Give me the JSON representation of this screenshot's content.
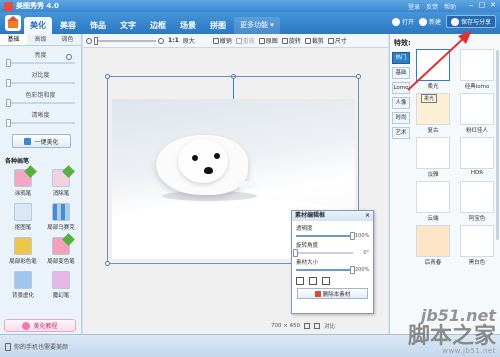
{
  "app": {
    "title": "美图秀秀 4.0"
  },
  "titlebar_links": [
    "登录",
    "反馈",
    "帮助"
  ],
  "tabs": [
    {
      "label": "美化",
      "active": true
    },
    {
      "label": "美容",
      "active": false
    },
    {
      "label": "饰品",
      "active": false
    },
    {
      "label": "文字",
      "active": false
    },
    {
      "label": "边框",
      "active": false
    },
    {
      "label": "场景",
      "active": false
    },
    {
      "label": "拼图",
      "active": false
    }
  ],
  "more_functions": "更多功能 ▾",
  "top_actions": {
    "open": "打开",
    "new": "新建",
    "save_share": "保存与分享"
  },
  "left": {
    "subtabs": [
      "基础",
      "高级",
      "调色"
    ],
    "sliders": [
      {
        "label": "亮度",
        "value": 0
      },
      {
        "label": "对比度",
        "value": 0
      },
      {
        "label": "色彩饱和度",
        "value": 0
      },
      {
        "label": "清晰度",
        "value": 0
      }
    ],
    "onekey": "一键美化",
    "brushes_title": "各种画笔",
    "tools": [
      {
        "label": "涂鸦笔",
        "new": true
      },
      {
        "label": "消除笔",
        "new": true
      },
      {
        "label": "抠图笔",
        "new": false
      },
      {
        "label": "局部马赛克",
        "new": false
      },
      {
        "label": "局部彩色笔",
        "new": false
      },
      {
        "label": "局部变色笔",
        "new": true
      },
      {
        "label": "背景虚化",
        "new": false
      },
      {
        "label": "魔幻笔",
        "new": false
      }
    ],
    "tutorial": "美化教程"
  },
  "toolbar": {
    "ratio": "1:1",
    "original": "原大",
    "undo": "撤销",
    "redo": "重做",
    "orig_image": "原图",
    "rotate": "旋转",
    "crop": "裁剪",
    "size": "尺寸"
  },
  "canvas": {
    "dimensions": "700 × 450",
    "compare": "对比"
  },
  "material_panel": {
    "title": "素材编辑框",
    "transparency_label": "透明度",
    "transparency_value": "100%",
    "transparency": 1.0,
    "rotation_label": "旋转角度",
    "rotation_value": "0°",
    "rotation": 0.0,
    "size_label": "素材大小",
    "size_value": "200%",
    "size": 1.0,
    "delete": "删除本素材"
  },
  "right": {
    "title": "特效:",
    "categories": [
      {
        "label": "热门",
        "active": true
      },
      {
        "label": "基础",
        "active": false
      },
      {
        "label": "Lomo",
        "active": false
      },
      {
        "label": "人像",
        "active": false
      },
      {
        "label": "时尚",
        "active": false
      },
      {
        "label": "艺术",
        "active": false
      }
    ],
    "effects": [
      {
        "label": "柔光",
        "selected": true
      },
      {
        "label": "经典lomo",
        "selected": false
      },
      {
        "label": "复古",
        "selected": false
      },
      {
        "label": "粉红佳人",
        "selected": false
      },
      {
        "label": "淡雅",
        "selected": false
      },
      {
        "label": "HDR",
        "selected": false
      },
      {
        "label": "云端",
        "selected": false
      },
      {
        "label": "阿宝色",
        "selected": false
      },
      {
        "label": "后青春",
        "selected": false
      },
      {
        "label": "黑白色",
        "selected": false
      }
    ],
    "tooltip": "柔光"
  },
  "bottom": {
    "phone_promo": "你的手机也需要美颜"
  },
  "watermark": {
    "line1": "jb51.net",
    "line2": "脚本之家",
    "line3": "www.jb51.net"
  },
  "colors": {
    "accent": "#3b86cf",
    "tab_bar": "#2c78c1",
    "arrow": "#e23030"
  }
}
